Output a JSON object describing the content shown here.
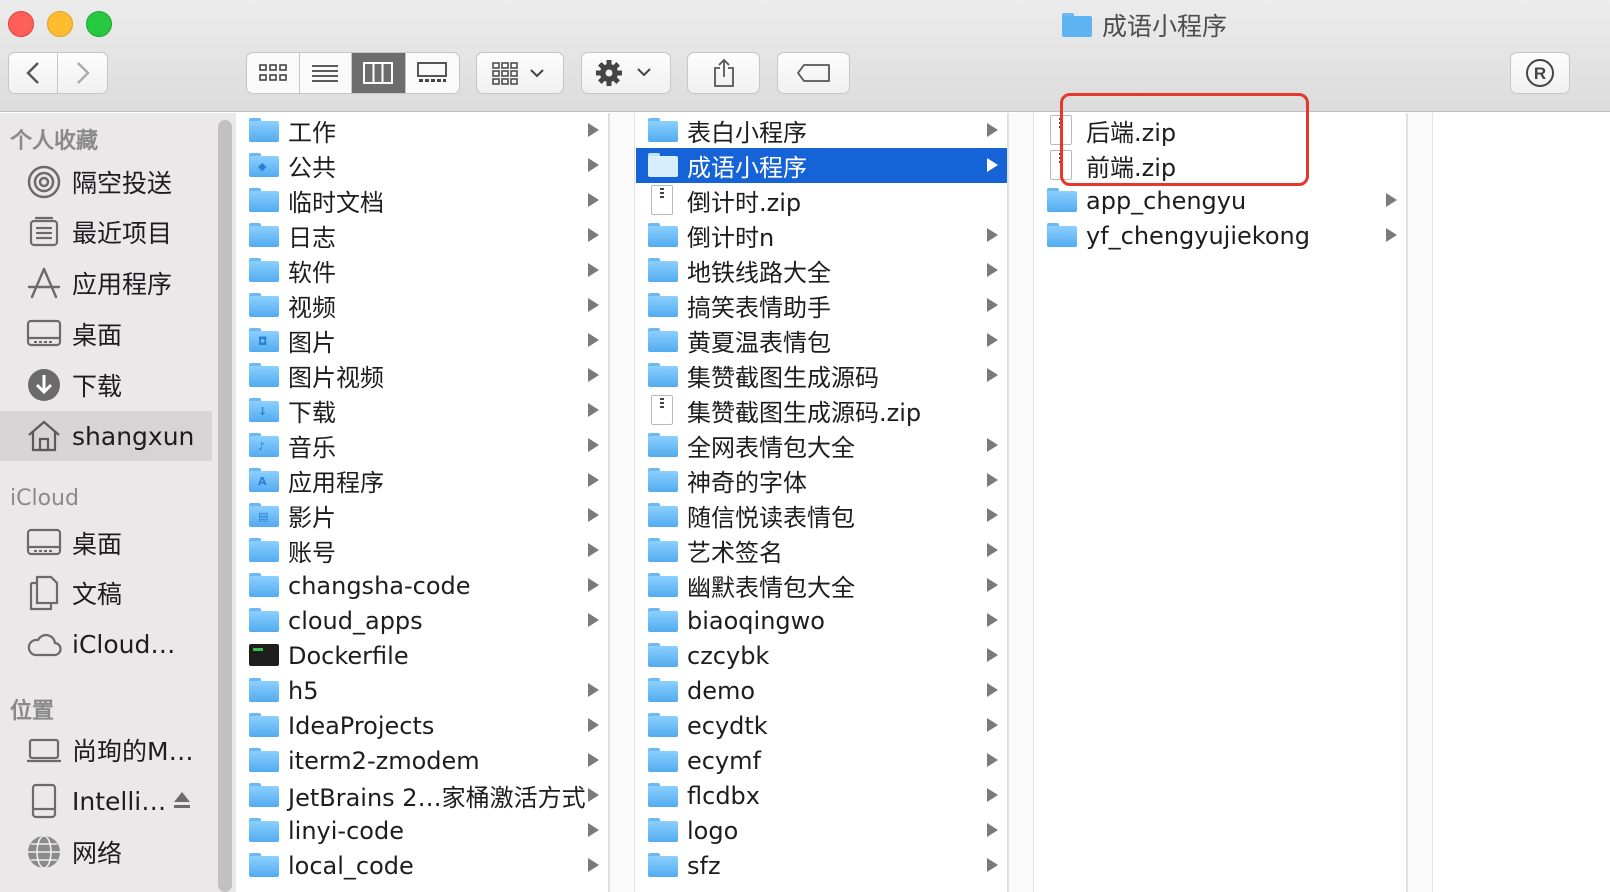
{
  "window": {
    "title": "成语小程序",
    "title_icon": "folder-icon"
  },
  "toolbar": {
    "back_icon": "chevron-left-icon",
    "forward_icon": "chevron-right-icon",
    "view_modes": [
      "icon-view",
      "list-view",
      "column-view",
      "gallery-view"
    ],
    "active_view": "column-view",
    "group_icon": "group-by-icon",
    "action_icon": "gear-icon",
    "share_icon": "share-icon",
    "tag_icon": "tag-icon",
    "extension_icon": "registered-icon"
  },
  "sidebar": {
    "favorites_header": "个人收藏",
    "favorites": [
      {
        "label": "隔空投送",
        "icon": "airdrop-icon"
      },
      {
        "label": "最近项目",
        "icon": "recents-icon"
      },
      {
        "label": "应用程序",
        "icon": "applications-icon"
      },
      {
        "label": "桌面",
        "icon": "desktop-icon"
      },
      {
        "label": "下载",
        "icon": "downloads-icon"
      },
      {
        "label": "shangxun",
        "icon": "home-icon",
        "selected": true
      }
    ],
    "icloud_header": "iCloud",
    "icloud": [
      {
        "label": "桌面",
        "icon": "desktop-icon"
      },
      {
        "label": "文稿",
        "icon": "documents-icon"
      },
      {
        "label": "iCloud…",
        "icon": "icloud-icon"
      }
    ],
    "locations_header": "位置",
    "locations": [
      {
        "label": "尚珣的M…",
        "icon": "laptop-icon"
      },
      {
        "label": "Intelli…",
        "icon": "disk-icon",
        "eject": true
      },
      {
        "label": "网络",
        "icon": "network-icon"
      }
    ]
  },
  "columns": [
    {
      "items": [
        {
          "name": "工作",
          "type": "folder",
          "arrow": true
        },
        {
          "name": "公共",
          "type": "folder-special",
          "glyph": "◆",
          "arrow": true
        },
        {
          "name": "临时文档",
          "type": "folder",
          "arrow": true
        },
        {
          "name": "日志",
          "type": "folder",
          "arrow": true
        },
        {
          "name": "软件",
          "type": "folder",
          "arrow": true
        },
        {
          "name": "视频",
          "type": "folder",
          "arrow": true
        },
        {
          "name": "图片",
          "type": "folder-special",
          "glyph": "◘",
          "arrow": true
        },
        {
          "name": "图片视频",
          "type": "folder",
          "arrow": true
        },
        {
          "name": "下载",
          "type": "folder-special",
          "glyph": "↓",
          "arrow": true
        },
        {
          "name": "音乐",
          "type": "folder-special",
          "glyph": "♪",
          "arrow": true
        },
        {
          "name": "应用程序",
          "type": "folder-special",
          "glyph": "A",
          "arrow": true
        },
        {
          "name": "影片",
          "type": "folder-special",
          "glyph": "▤",
          "arrow": true
        },
        {
          "name": "账号",
          "type": "folder",
          "arrow": true
        },
        {
          "name": "changsha-code",
          "type": "folder",
          "arrow": true
        },
        {
          "name": "cloud_apps",
          "type": "folder",
          "arrow": true
        },
        {
          "name": "Dockerfile",
          "type": "terminal",
          "arrow": false
        },
        {
          "name": "h5",
          "type": "folder",
          "arrow": true
        },
        {
          "name": "IdeaProjects",
          "type": "folder",
          "arrow": true
        },
        {
          "name": "iterm2-zmodem",
          "type": "folder",
          "arrow": true
        },
        {
          "name": "JetBrains 2…家桶激活方式",
          "type": "folder",
          "arrow": true
        },
        {
          "name": "linyi-code",
          "type": "folder",
          "arrow": true
        },
        {
          "name": "local_code",
          "type": "folder",
          "arrow": true
        }
      ]
    },
    {
      "items": [
        {
          "name": "表白小程序",
          "type": "folder",
          "arrow": true
        },
        {
          "name": "成语小程序",
          "type": "folder",
          "arrow": true,
          "selected": true
        },
        {
          "name": "倒计时.zip",
          "type": "zip",
          "arrow": false
        },
        {
          "name": "倒计时n",
          "type": "folder",
          "arrow": true
        },
        {
          "name": "地铁线路大全",
          "type": "folder",
          "arrow": true
        },
        {
          "name": "搞笑表情助手",
          "type": "folder",
          "arrow": true
        },
        {
          "name": "黄夏温表情包",
          "type": "folder",
          "arrow": true
        },
        {
          "name": "集赞截图生成源码",
          "type": "folder",
          "arrow": true
        },
        {
          "name": "集赞截图生成源码.zip",
          "type": "zip",
          "arrow": false
        },
        {
          "name": "全网表情包大全",
          "type": "folder",
          "arrow": true
        },
        {
          "name": "神奇的字体",
          "type": "folder",
          "arrow": true
        },
        {
          "name": "随信悦读表情包",
          "type": "folder",
          "arrow": true
        },
        {
          "name": "艺术签名",
          "type": "folder",
          "arrow": true
        },
        {
          "name": "幽默表情包大全",
          "type": "folder",
          "arrow": true
        },
        {
          "name": "biaoqingwo",
          "type": "folder",
          "arrow": true
        },
        {
          "name": "czcybk",
          "type": "folder",
          "arrow": true
        },
        {
          "name": "demo",
          "type": "folder",
          "arrow": true
        },
        {
          "name": "ecydtk",
          "type": "folder",
          "arrow": true
        },
        {
          "name": "ecymf",
          "type": "folder",
          "arrow": true
        },
        {
          "name": "flcdbx",
          "type": "folder",
          "arrow": true
        },
        {
          "name": "logo",
          "type": "folder",
          "arrow": true
        },
        {
          "name": "sfz",
          "type": "folder",
          "arrow": true
        }
      ]
    },
    {
      "items": [
        {
          "name": "后端.zip",
          "type": "zip",
          "arrow": false
        },
        {
          "name": "前端.zip",
          "type": "zip",
          "arrow": false
        },
        {
          "name": "app_chengyu",
          "type": "folder",
          "arrow": true
        },
        {
          "name": "yf_chengyujiekong",
          "type": "folder",
          "arrow": true
        }
      ]
    }
  ],
  "annotation": {
    "color": "#e5372b",
    "target": "zip files in 成语小程序"
  },
  "colors": {
    "selection": "#1663d8",
    "folder": "#5eb3f2",
    "sidebar": "#eae8e8"
  }
}
